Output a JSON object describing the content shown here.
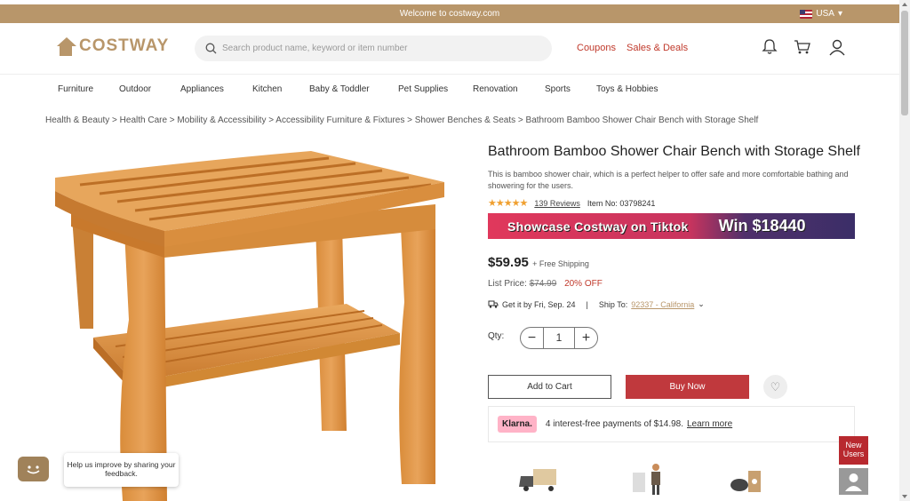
{
  "topbar": {
    "welcome": "Welcome to costway.com",
    "region": "USA"
  },
  "header": {
    "logo_text": "COSTWAY",
    "search_placeholder": "Search product name, keyword or item number",
    "coupons": "Coupons",
    "sales": "Sales & Deals",
    "icons": [
      "bell-icon",
      "cart-icon",
      "user-icon"
    ]
  },
  "nav": {
    "items": [
      "Furniture",
      "Outdoor",
      "Appliances",
      "Kitchen",
      "Baby & Toddler",
      "Pet Supplies",
      "Renovation",
      "Sports",
      "Toys & Hobbies"
    ]
  },
  "breadcrumb": "Health & Beauty > Health Care > Mobility & Accessibility > Accessibility Furniture & Fixtures > Shower Benches & Seats >  Bathroom Bamboo Shower Chair Bench with Storage Shelf",
  "product": {
    "title": "Bathroom Bamboo Shower Chair Bench with Storage Shelf",
    "description": "This is bamboo shower chair, which is a perfect helper to offer safe and more comfortable bathing and showering for the users.",
    "stars": "★★★★★",
    "reviews": "139 Reviews",
    "item_no": "Item No: 03798241",
    "banner_left": "Showcase Costway on Tiktok",
    "banner_right": "Win $18440",
    "price": "$59.95",
    "shipping": "+ Free Shipping",
    "list_price_label": "List Price:",
    "list_price": "$74.99",
    "discount": "20% OFF",
    "delivery": "Get it by Fri, Sep. 24",
    "separator": "|",
    "ship_to_label": "Ship To:",
    "ship_to_zip": "92337 - California",
    "qty_label": "Qty:",
    "qty_value": "1",
    "add_to_cart": "Add to Cart",
    "buy_now": "Buy Now"
  },
  "klarna": {
    "badge": "Klarna.",
    "text": "4 interest-free payments of $14.98.",
    "learn_more": "Learn more"
  },
  "chat": {
    "bubble": "Help us improve by sharing your feedback."
  },
  "new_users": "New Users",
  "colors": {
    "brand": "#b8966a",
    "accent_red": "#c0393d",
    "klarna_pink": "#ffb3c7"
  }
}
